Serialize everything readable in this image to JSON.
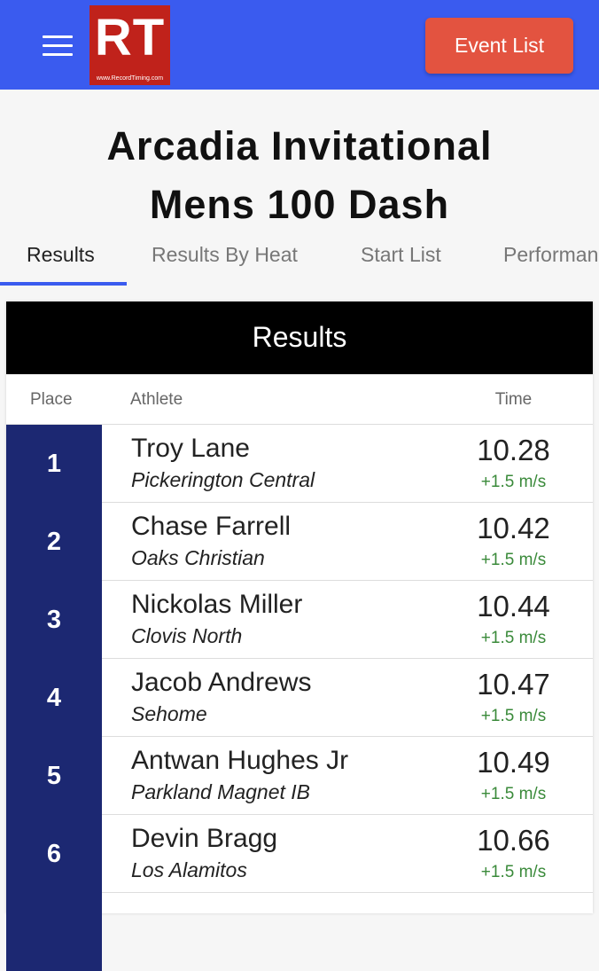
{
  "header": {
    "logo_text": "RT",
    "logo_url": "www.RecordTiming.com",
    "event_list_label": "Event List"
  },
  "page": {
    "title_line1": "Arcadia Invitational",
    "title_line2": "Mens 100 Dash"
  },
  "tabs": [
    "Results",
    "Results By Heat",
    "Start List",
    "Performan"
  ],
  "results": {
    "title": "Results",
    "columns": {
      "place": "Place",
      "athlete": "Athlete",
      "time": "Time"
    },
    "rows": [
      {
        "place": "1",
        "athlete": "Troy Lane",
        "team": "Pickerington Central",
        "time": "10.28",
        "wind": "+1.5 m/s"
      },
      {
        "place": "2",
        "athlete": "Chase Farrell",
        "team": "Oaks Christian",
        "time": "10.42",
        "wind": "+1.5 m/s"
      },
      {
        "place": "3",
        "athlete": "Nickolas Miller",
        "team": "Clovis North",
        "time": "10.44",
        "wind": "+1.5 m/s"
      },
      {
        "place": "4",
        "athlete": "Jacob Andrews",
        "team": "Sehome",
        "time": "10.47",
        "wind": "+1.5 m/s"
      },
      {
        "place": "5",
        "athlete": "Antwan Hughes Jr",
        "team": "Parkland Magnet IB",
        "time": "10.49",
        "wind": "+1.5 m/s"
      },
      {
        "place": "6",
        "athlete": "Devin Bragg",
        "team": "Los Alamitos",
        "time": "10.66",
        "wind": "+1.5 m/s"
      }
    ]
  },
  "colors": {
    "topbar": "#3a5bef",
    "logo_red": "#c0221b",
    "button_red": "#e35340",
    "place_navy": "#1c2872",
    "wind_green": "#3a8a3a"
  }
}
